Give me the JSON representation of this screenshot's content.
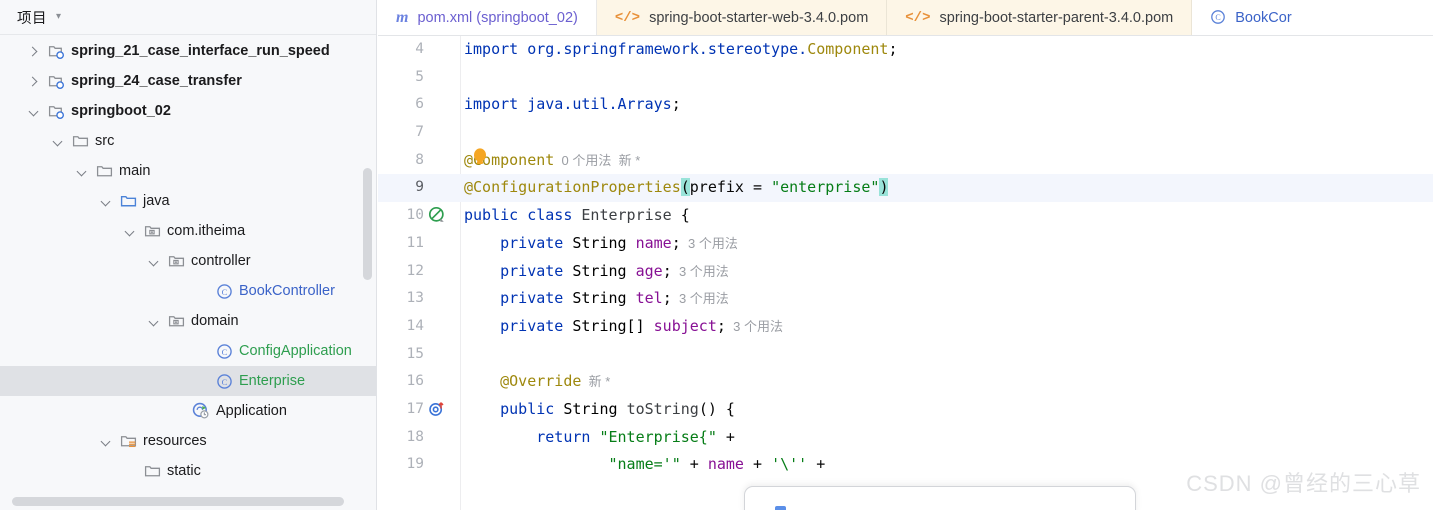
{
  "sidebar": {
    "title": "项目",
    "chevron_icon": "chevron-down-icon",
    "tree": [
      {
        "label": "spring_21_case_interface_run_speed",
        "icon": "module-folder-icon",
        "indent": 1,
        "twisty": "closed",
        "style": "bold"
      },
      {
        "label": "spring_24_case_transfer",
        "icon": "module-folder-icon",
        "indent": 1,
        "twisty": "closed",
        "style": "bold"
      },
      {
        "label": "springboot_02",
        "icon": "module-folder-icon",
        "indent": 1,
        "twisty": "open",
        "style": "bold"
      },
      {
        "label": "src",
        "icon": "folder-icon",
        "indent": 2,
        "twisty": "open",
        "style": "plain"
      },
      {
        "label": "main",
        "icon": "folder-icon",
        "indent": 3,
        "twisty": "open",
        "style": "plain"
      },
      {
        "label": "java",
        "icon": "source-folder-icon",
        "indent": 4,
        "twisty": "open",
        "style": "plain"
      },
      {
        "label": "com.itheima",
        "icon": "package-icon",
        "indent": 5,
        "twisty": "open",
        "style": "plain"
      },
      {
        "label": "controller",
        "icon": "package-icon",
        "indent": 6,
        "twisty": "open",
        "style": "plain"
      },
      {
        "label": "BookController",
        "icon": "java-class-icon",
        "indent": 8,
        "twisty": "none",
        "style": "blue"
      },
      {
        "label": "domain",
        "icon": "package-icon",
        "indent": 6,
        "twisty": "open",
        "style": "plain"
      },
      {
        "label": "ConfigApplication",
        "icon": "java-class-icon",
        "indent": 8,
        "twisty": "none",
        "style": "green"
      },
      {
        "label": "Enterprise",
        "icon": "java-class-icon",
        "indent": 8,
        "twisty": "none",
        "style": "green",
        "selected": true
      },
      {
        "label": "Application",
        "icon": "spring-boot-run-icon",
        "indent": 7,
        "twisty": "none",
        "style": "plain"
      },
      {
        "label": "resources",
        "icon": "resources-folder-icon",
        "indent": 4,
        "twisty": "open",
        "style": "plain"
      },
      {
        "label": "static",
        "icon": "folder-icon",
        "indent": 5,
        "twisty": "none",
        "style": "plain"
      }
    ],
    "vertical_scrollbar": "sidebar-vertical-scrollbar",
    "horizontal_scrollbar": "sidebar-horizontal-scrollbar"
  },
  "tabs": [
    {
      "label": "pom.xml (springboot_02)",
      "icon": "maven-m-icon",
      "state": "active",
      "label_color": "purple"
    },
    {
      "label": "spring-boot-starter-web-3.4.0.pom",
      "icon": "xml-file-icon",
      "state": "inactive",
      "label_color": "dark"
    },
    {
      "label": "spring-boot-starter-parent-3.4.0.pom",
      "icon": "xml-file-icon",
      "state": "inactive",
      "label_color": "dark"
    },
    {
      "label": "BookCor",
      "icon": "java-class-icon",
      "state": "clipped",
      "label_color": "blue"
    }
  ],
  "editor": {
    "lines": [
      {
        "n": "4",
        "gutter": "none",
        "current": false,
        "tokens": [
          {
            "t": "import ",
            "c": "kw"
          },
          {
            "t": "org.springframework.stereotype.",
            "c": "kw"
          },
          {
            "t": "Component",
            "c": "anno"
          },
          {
            "t": ";",
            "c": "punc"
          }
        ]
      },
      {
        "n": "5",
        "gutter": "none",
        "current": false,
        "tokens": []
      },
      {
        "n": "6",
        "gutter": "none",
        "current": false,
        "tokens": [
          {
            "t": "import ",
            "c": "kw"
          },
          {
            "t": "java.util.Arrays",
            "c": "kw"
          },
          {
            "t": ";",
            "c": "punc"
          }
        ]
      },
      {
        "n": "7",
        "gutter": "none",
        "current": false,
        "tokens": []
      },
      {
        "n": "8",
        "gutter": "none",
        "current": false,
        "bulb": true,
        "tokens": [
          {
            "t": "@Component",
            "c": "anno"
          },
          {
            "t": "  0 个用法  新 *",
            "c": "hint"
          }
        ]
      },
      {
        "n": "9",
        "gutter": "none",
        "current": true,
        "tokens": [
          {
            "t": "@ConfigurationProperties",
            "c": "anno"
          },
          {
            "t": "(",
            "c": "brace"
          },
          {
            "t": "prefix ",
            "c": "punc"
          },
          {
            "t": "= ",
            "c": "punc"
          },
          {
            "t": "\"enterprise\"",
            "c": "str"
          },
          {
            "t": ")",
            "c": "brace"
          }
        ]
      },
      {
        "n": "10",
        "gutter": "suppress-inspection-icon",
        "current": false,
        "tokens": [
          {
            "t": "public class ",
            "c": "kw"
          },
          {
            "t": "Enterprise",
            "c": "cls"
          },
          {
            "t": " {",
            "c": "punc"
          }
        ]
      },
      {
        "n": "11",
        "gutter": "none",
        "current": false,
        "tokens": [
          {
            "t": "    private ",
            "c": "kw"
          },
          {
            "t": "String ",
            "c": "type"
          },
          {
            "t": "name",
            "c": "fld"
          },
          {
            "t": ";",
            "c": "punc"
          },
          {
            "t": "  3 个用法",
            "c": "hint"
          }
        ]
      },
      {
        "n": "12",
        "gutter": "none",
        "current": false,
        "tokens": [
          {
            "t": "    private ",
            "c": "kw"
          },
          {
            "t": "String ",
            "c": "type"
          },
          {
            "t": "age",
            "c": "fld"
          },
          {
            "t": ";",
            "c": "punc"
          },
          {
            "t": "  3 个用法",
            "c": "hint"
          }
        ]
      },
      {
        "n": "13",
        "gutter": "none",
        "current": false,
        "tokens": [
          {
            "t": "    private ",
            "c": "kw"
          },
          {
            "t": "String ",
            "c": "type"
          },
          {
            "t": "tel",
            "c": "fld"
          },
          {
            "t": ";",
            "c": "punc"
          },
          {
            "t": "  3 个用法",
            "c": "hint"
          }
        ]
      },
      {
        "n": "14",
        "gutter": "none",
        "current": false,
        "tokens": [
          {
            "t": "    private ",
            "c": "kw"
          },
          {
            "t": "String[] ",
            "c": "type"
          },
          {
            "t": "subject",
            "c": "fld"
          },
          {
            "t": ";",
            "c": "punc"
          },
          {
            "t": "  3 个用法",
            "c": "hint"
          }
        ]
      },
      {
        "n": "15",
        "gutter": "none",
        "current": false,
        "tokens": []
      },
      {
        "n": "16",
        "gutter": "none",
        "current": false,
        "tokens": [
          {
            "t": "    @Override",
            "c": "anno"
          },
          {
            "t": "  新 *",
            "c": "hint"
          }
        ]
      },
      {
        "n": "17",
        "gutter": "overrides-method-icon",
        "current": false,
        "tokens": [
          {
            "t": "    public ",
            "c": "kw"
          },
          {
            "t": "String ",
            "c": "type"
          },
          {
            "t": "toString",
            "c": "cls"
          },
          {
            "t": "() {",
            "c": "punc"
          }
        ]
      },
      {
        "n": "18",
        "gutter": "none",
        "current": false,
        "tokens": [
          {
            "t": "        return ",
            "c": "kw"
          },
          {
            "t": "\"Enterprise{\"",
            "c": "str"
          },
          {
            "t": " +",
            "c": "punc"
          }
        ]
      },
      {
        "n": "19",
        "gutter": "none",
        "current": false,
        "tokens": [
          {
            "t": "                ",
            "c": "punc"
          },
          {
            "t": "\"name='\"",
            "c": "str"
          },
          {
            "t": " + ",
            "c": "punc"
          },
          {
            "t": "name",
            "c": "fld"
          },
          {
            "t": " + ",
            "c": "punc"
          },
          {
            "t": "'\\''",
            "c": "str"
          },
          {
            "t": " +",
            "c": "punc"
          }
        ]
      }
    ]
  },
  "popup": {
    "name": "completion-popup",
    "dot_icon": "popup-indicator-icon"
  },
  "watermark": {
    "text": "CSDN @曾经的三心草"
  },
  "colors": {
    "accent_blue": "#3b63c8",
    "keyword_blue": "#0033b3",
    "annotation_gold": "#9e880d",
    "string_green": "#067d17",
    "field_purple": "#871094",
    "tab_inactive_bg": "#fdf6e7",
    "selection_gray": "#dfe1e5",
    "current_line_bg": "#f3f6fd",
    "brace_match": "#99e3d9"
  }
}
